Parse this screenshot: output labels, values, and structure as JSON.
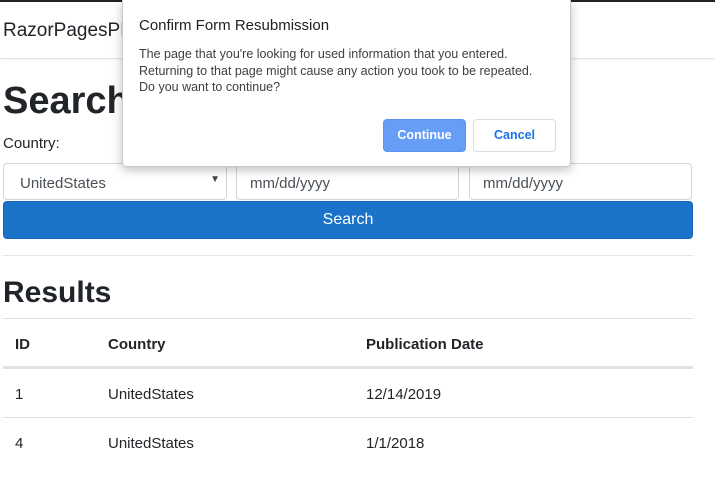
{
  "navbar": {
    "brand": "RazorPagesPR"
  },
  "search": {
    "heading": "Search",
    "country_label": "Country:",
    "country_value": "UnitedStates",
    "date_from_placeholder": "mm/dd/yyyy",
    "date_to_placeholder": "mm/dd/yyyy",
    "button_label": "Search"
  },
  "results": {
    "heading": "Results",
    "columns": [
      "ID",
      "Country",
      "Publication Date"
    ],
    "rows": [
      [
        "1",
        "UnitedStates",
        "12/14/2019"
      ],
      [
        "4",
        "UnitedStates",
        "1/1/2018"
      ]
    ]
  },
  "dialog": {
    "title": "Confirm Form Resubmission",
    "message_lines": [
      "The page that you're looking for used information that you entered.",
      "Returning to that page might cause any action you took to be repeated.",
      "Do you want to continue?"
    ],
    "continue_label": "Continue",
    "cancel_label": "Cancel"
  },
  "colors": {
    "primary": "#1a73c9",
    "dialog_primary": "#669df6",
    "dialog_link": "#1a73e8"
  }
}
